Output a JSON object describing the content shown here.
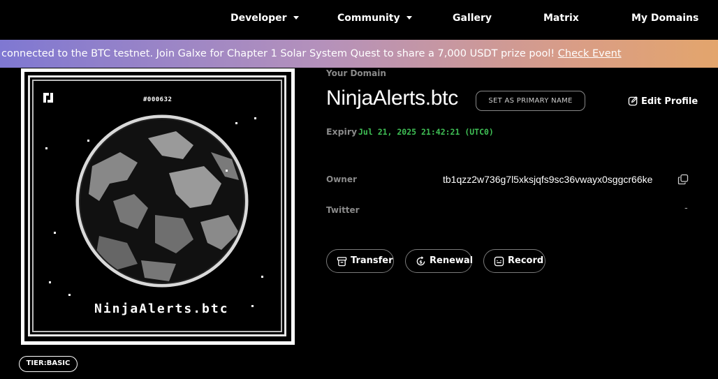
{
  "nav": {
    "items": [
      {
        "label": "Developer",
        "dropdown": true
      },
      {
        "label": "Community",
        "dropdown": true
      },
      {
        "label": "Gallery",
        "dropdown": false
      },
      {
        "label": "Matrix",
        "dropdown": false
      },
      {
        "label": "My Domains",
        "dropdown": false
      }
    ]
  },
  "banner": {
    "text": "connected to the BTC testnet. Join Galxe for Chapter 1 Solar System Quest to share a 7,000 USDT prize pool! ",
    "link": "Check Event"
  },
  "card": {
    "number": "#000632",
    "name": "NinjaAlerts.btc"
  },
  "tier": "TIER:BASIC",
  "domain": {
    "section_label": "Your Domain",
    "name": "NinjaAlerts.btc",
    "primary_button": "SET AS PRIMARY NAME",
    "edit_profile": "Edit Profile",
    "expiry_label": "Expiry",
    "expiry_value": "Jul 21, 2025 21:42:21 (UTC0)",
    "owner_label": "Owner",
    "owner_value": "tb1qzz2w736g7l5xksjqfs9sc36vwayx0sggcr66ke",
    "twitter_label": "Twitter",
    "twitter_value": "-"
  },
  "actions": {
    "transfer": "Transfer",
    "renewal": "Renewal",
    "record": "Record"
  },
  "colors": {
    "expiry": "#3fbf55",
    "banner_start": "#7f78d2",
    "banner_end": "#e3a56c"
  },
  "icons": [
    "chevron-down-icon",
    "logo-icon",
    "edit-icon",
    "copy-icon",
    "transfer-icon",
    "renewal-icon",
    "record-icon"
  ]
}
